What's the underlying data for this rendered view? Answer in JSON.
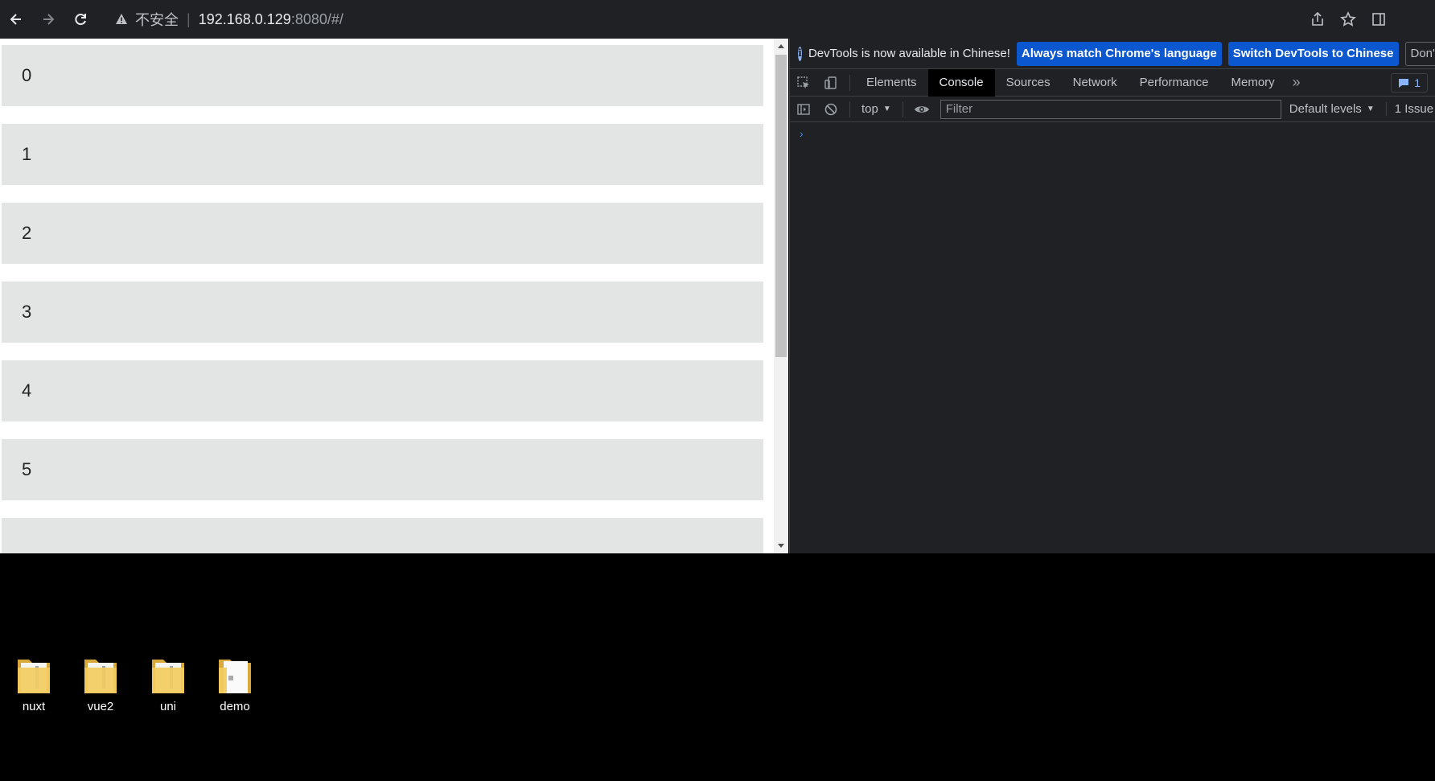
{
  "browser": {
    "security_label": "不安全",
    "separator": "|",
    "url_host": "192.168.0.129",
    "url_path": ":8080/#/"
  },
  "page": {
    "items": [
      "0",
      "1",
      "2",
      "3",
      "4",
      "5"
    ]
  },
  "devtools": {
    "info": {
      "message": "DevTools is now available in Chinese!",
      "btn_match": "Always match Chrome's language",
      "btn_switch": "Switch DevTools to Chinese",
      "btn_dismiss": "Don't show again"
    },
    "tabs": [
      "Elements",
      "Console",
      "Sources",
      "Network",
      "Performance",
      "Memory"
    ],
    "active_tab": "Console",
    "issue_badge_count": "1",
    "console": {
      "context": "top",
      "filter_placeholder": "Filter",
      "levels": "Default levels",
      "issues": "1 Issue"
    },
    "prompt_symbol": "›"
  },
  "desktop": {
    "icons": [
      "nuxt",
      "vue2",
      "uni",
      "demo"
    ]
  },
  "colors": {
    "item_bg": "#e3e5e4",
    "devtools_bg": "#202124",
    "accent_blue": "#0b57d0"
  }
}
